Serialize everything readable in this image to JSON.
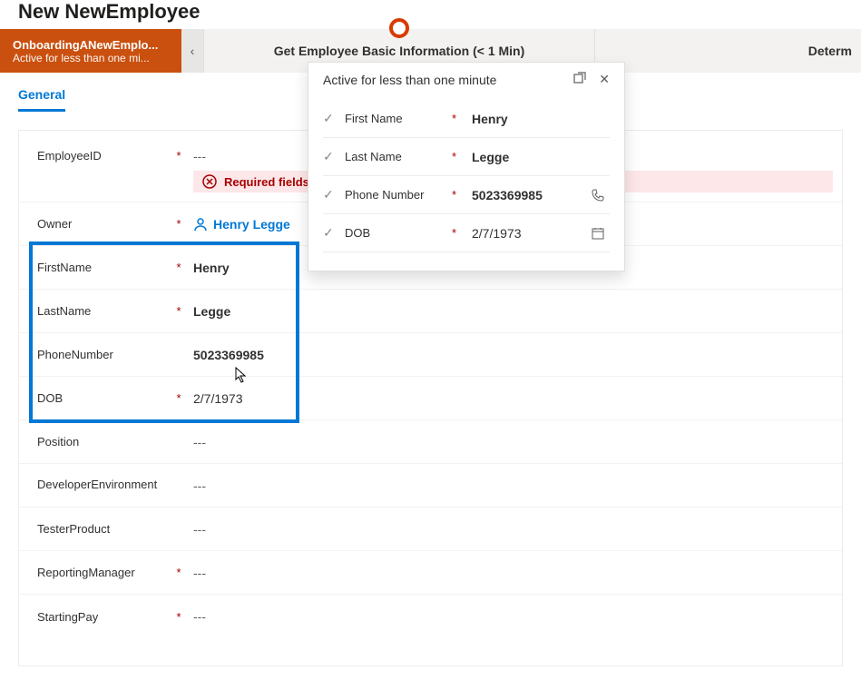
{
  "page": {
    "title": "New NewEmployee"
  },
  "stages": {
    "active": {
      "name": "OnboardingANewEmplo...",
      "sub": "Active for less than one mi..."
    },
    "mid": "Get Employee Basic Information  (< 1 Min)",
    "right": "Determ"
  },
  "tabs": {
    "general": "General"
  },
  "form": {
    "employeeId": {
      "label": "EmployeeID",
      "value": "---",
      "error": "Required fields"
    },
    "owner": {
      "label": "Owner",
      "value": "Henry Legge"
    },
    "firstName": {
      "label": "FirstName",
      "value": "Henry"
    },
    "lastName": {
      "label": "LastName",
      "value": "Legge"
    },
    "phone": {
      "label": "PhoneNumber",
      "value": "5023369985"
    },
    "dob": {
      "label": "DOB",
      "value": "2/7/1973"
    },
    "position": {
      "label": "Position",
      "value": "---"
    },
    "devEnv": {
      "label": "DeveloperEnvironment",
      "value": "---"
    },
    "tester": {
      "label": "TesterProduct",
      "value": "---"
    },
    "manager": {
      "label": "ReportingManager",
      "value": "---"
    },
    "pay": {
      "label": "StartingPay",
      "value": "---"
    }
  },
  "flyout": {
    "header": "Active for less than one minute",
    "rows": {
      "first": {
        "label": "First Name",
        "value": "Henry"
      },
      "last": {
        "label": "Last Name",
        "value": "Legge"
      },
      "phone": {
        "label": "Phone Number",
        "value": "5023369985"
      },
      "dob": {
        "label": "DOB",
        "value": "2/7/1973"
      }
    }
  },
  "glyphs": {
    "req": "*",
    "dash": "---",
    "check": "✓",
    "close": "✕",
    "chevronLeft": "‹"
  }
}
